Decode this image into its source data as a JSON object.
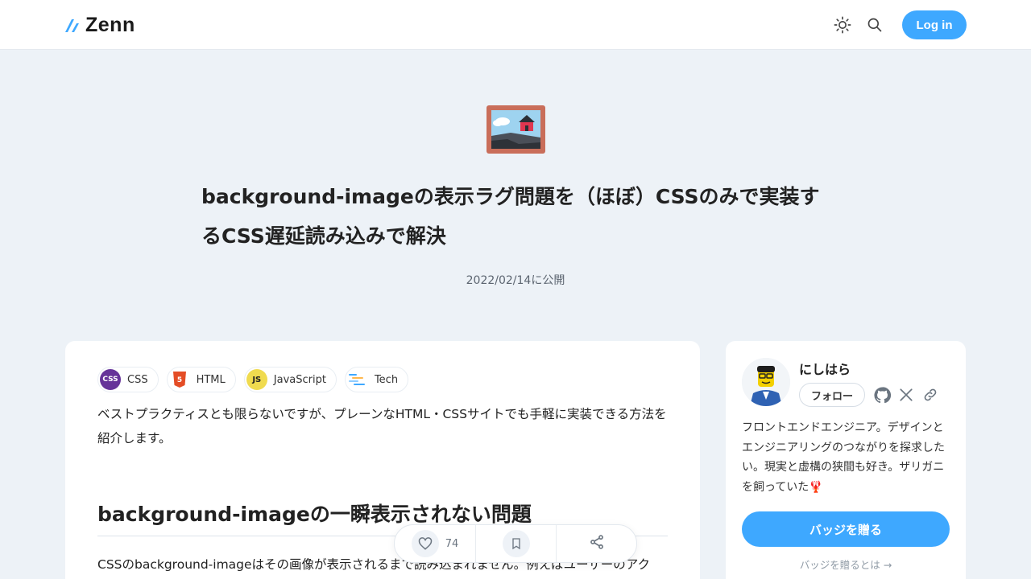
{
  "header": {
    "logo_text": "Zenn",
    "login_label": "Log in",
    "icons": [
      "theme-toggle-icon",
      "search-icon"
    ],
    "accent_color": "#3ea8ff"
  },
  "article": {
    "title": "background-imageの表示ラグ問題を（ほぼ）CSSのみで実装するCSS遅延読み込みで解決",
    "published": "2022/02/14に公開",
    "topics": [
      {
        "label": "CSS",
        "icon": "css-icon"
      },
      {
        "label": "HTML",
        "icon": "html5-icon"
      },
      {
        "label": "JavaScript",
        "icon": "javascript-icon"
      },
      {
        "label": "Tech",
        "icon": "tech-icon"
      }
    ],
    "intro": "ベストプラクティスとも限らないですが、プレーンなHTML・CSSサイトでも手軽に実装できる方法を紹介します。",
    "h2": "background-imageの一瞬表示されない問題",
    "paragraph": "CSSのbackground-imageはその画像が表示されるまで読み込まれません。例えばユーザーのアク"
  },
  "author": {
    "name": "にしはら",
    "follow_label": "フォロー",
    "bio": "フロントエンドエンジニア。デザインとエンジニアリングのつながりを探求したい。現実と虚構の狭間も好き。ザリガニを飼っていた🦞",
    "badge_button": "バッジを贈る",
    "badge_link": "バッジを贈るとは",
    "social_icons": [
      "github-icon",
      "x-icon",
      "link-icon"
    ]
  },
  "actions": {
    "like_count": "74"
  }
}
